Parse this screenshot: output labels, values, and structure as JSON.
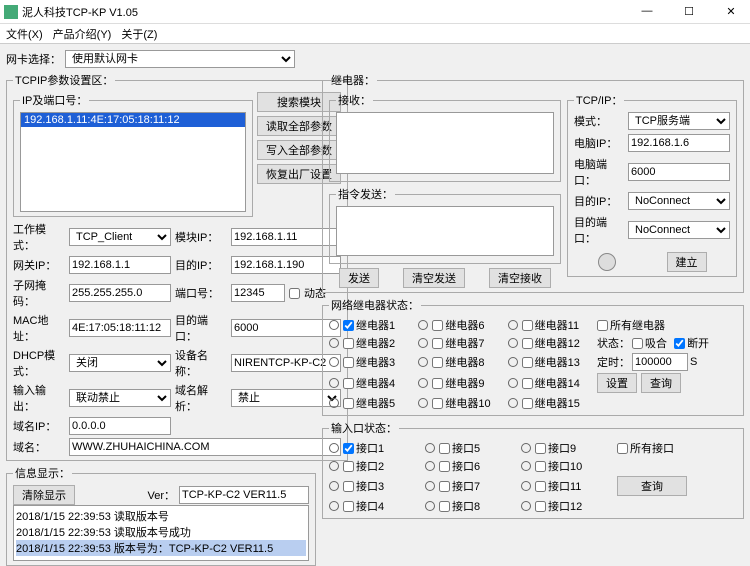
{
  "window": {
    "title": "泥人科技TCP-KP V1.05"
  },
  "menu": {
    "file": "文件(X)",
    "intro": "产品介绍(Y)",
    "about": "关于(Z)"
  },
  "winbtn": {
    "min": "—",
    "max": "☐",
    "close": "✕"
  },
  "nic": {
    "label": "网卡选择：",
    "value": "使用默认网卡"
  },
  "tcpip_box": "TCPIP参数设置区：",
  "iplist": {
    "legend": "IP及端口号：",
    "item": "192.168.1.11:4E:17:05:18:11:12"
  },
  "btns": {
    "search": "搜索模块",
    "readall": "读取全部参数",
    "writeall": "写入全部参数",
    "factory": "恢复出厂设置"
  },
  "p": {
    "workmode_l": "工作模式：",
    "workmode": "TCP_Client",
    "gw_l": "网关IP：",
    "gw": "192.168.1.1",
    "mask_l": "子网掩码：",
    "mask": "255.255.255.0",
    "mac_l": "MAC地址：",
    "mac": "4E:17:05:18:11:12",
    "dhcp_l": "DHCP模式：",
    "dhcp": "关闭",
    "io_l": "输入输出：",
    "io": "联动禁止",
    "dip_l": "域名IP：",
    "dip": "0.0.0.0",
    "dn_l": "域名：",
    "dn": "WWW.ZHUHAICHINA.COM",
    "modip_l": "模块IP：",
    "modip": "192.168.1.11",
    "dstip_l": "目的IP：",
    "dstip": "192.168.1.190",
    "port_l": "端口号：",
    "port": "12345",
    "dyn": "动态",
    "dstport_l": "目的端口：",
    "dstport": "6000",
    "devname_l": "设备名称：",
    "devname": "NIRENTCP-KP-C2",
    "dns_l": "域名解析：",
    "dns": "禁止"
  },
  "info": {
    "legend": "信息显示：",
    "clear": "清除显示",
    "ver_l": "Ver：",
    "ver": "TCP-KP-C2 VER11.5",
    "l1": "2018/1/15 22:39:53  读取版本号",
    "l2": "2018/1/15 22:39:53          读取版本号成功",
    "l3": "2018/1/15 22:39:53  版本号为：TCP-KP-C2  VER11.5"
  },
  "relay": {
    "legend": "继电器：",
    "recv": "接收：",
    "cmd": "指令发送：",
    "send": "发送",
    "clrsend": "清空发送",
    "clrrecv": "清空接收"
  },
  "tcp": {
    "legend": "TCP/IP：",
    "mode_l": "模式：",
    "mode": "TCP服务端",
    "pcip_l": "电脑IP：",
    "pcip": "192.168.1.6",
    "pcport_l": "电脑端口：",
    "pcport": "6000",
    "dip_l": "目的IP：",
    "dip": "NoConnect",
    "dport_l": "目的端口：",
    "dport": "NoConnect",
    "build": "建立"
  },
  "net": {
    "legend": "网络继电器状态：",
    "all": "所有继电器",
    "state_l": "状态：",
    "on": "吸合",
    "off": "断开",
    "timer_l": "定时：",
    "timer": "100000",
    "unit": "S",
    "set": "设置",
    "query": "查询",
    "r": [
      "继电器1",
      "继电器2",
      "继电器3",
      "继电器4",
      "继电器5",
      "继电器6",
      "继电器7",
      "继电器8",
      "继电器9",
      "继电器10",
      "继电器11",
      "继电器12",
      "继电器13",
      "继电器14",
      "继电器15"
    ]
  },
  "iostat": {
    "legend": "输入口状态：",
    "all": "所有接口",
    "query": "查询",
    "r": [
      "接口1",
      "接口2",
      "接口3",
      "接口4",
      "接口5",
      "接口6",
      "接口7",
      "接口8",
      "接口9",
      "接口10",
      "接口11",
      "接口12"
    ]
  }
}
